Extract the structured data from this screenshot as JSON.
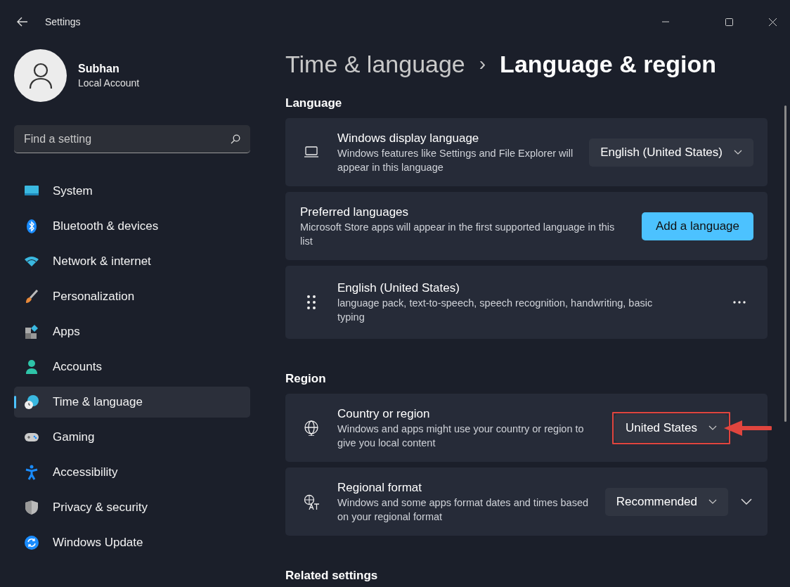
{
  "window": {
    "title": "Settings"
  },
  "account": {
    "name": "Subhan",
    "type": "Local Account"
  },
  "search": {
    "placeholder": "Find a setting"
  },
  "sidebar": {
    "items": [
      {
        "label": "System",
        "selected": false
      },
      {
        "label": "Bluetooth & devices",
        "selected": false
      },
      {
        "label": "Network & internet",
        "selected": false
      },
      {
        "label": "Personalization",
        "selected": false
      },
      {
        "label": "Apps",
        "selected": false
      },
      {
        "label": "Accounts",
        "selected": false
      },
      {
        "label": "Time & language",
        "selected": true
      },
      {
        "label": "Gaming",
        "selected": false
      },
      {
        "label": "Accessibility",
        "selected": false
      },
      {
        "label": "Privacy & security",
        "selected": false
      },
      {
        "label": "Windows Update",
        "selected": false
      }
    ]
  },
  "breadcrumb": {
    "parent": "Time & language",
    "separator": "›",
    "current": "Language & region"
  },
  "sections": [
    {
      "heading": "Language",
      "cards": [
        {
          "kind": "dropdown",
          "title": "Windows display language",
          "description": "Windows features like Settings and File Explorer will appear in this language",
          "value": "English (United States)",
          "highlighted": false
        },
        {
          "kind": "button",
          "title": "Preferred languages",
          "description": "Microsoft Store apps will appear in the first supported language in this list",
          "button": "Add a language"
        },
        {
          "kind": "language-item",
          "title": "English (United States)",
          "description": "language pack, text-to-speech, speech recognition, handwriting, basic typing"
        }
      ]
    },
    {
      "heading": "Region",
      "cards": [
        {
          "kind": "dropdown",
          "title": "Country or region",
          "description": "Windows and apps might use your country or region to give you local content",
          "value": "United States",
          "highlighted": true
        },
        {
          "kind": "dropdown-expand",
          "title": "Regional format",
          "description": "Windows and some apps format dates and times based on your regional format",
          "value": "Recommended",
          "expanded": false
        }
      ]
    },
    {
      "heading": "Related settings"
    }
  ]
}
